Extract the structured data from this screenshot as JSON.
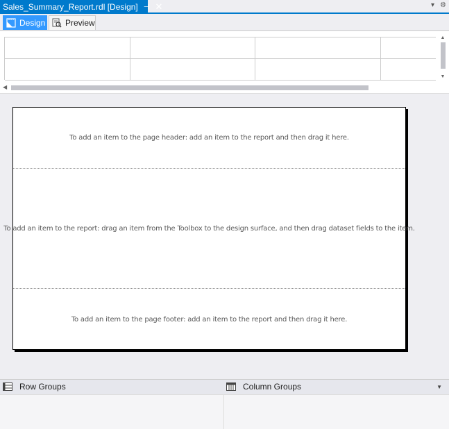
{
  "document_tab": {
    "title": "Sales_Summary_Report.rdl [Design]",
    "pin_glyph": "⊣",
    "close_glyph": "✕"
  },
  "window_controls": {
    "dropdown_glyph": "▾",
    "settings_glyph": "⚙"
  },
  "mode_tabs": {
    "design_label": "Design",
    "preview_label": "Preview",
    "active": "Design"
  },
  "dataset_grid": {
    "rows": 2,
    "columns": 4
  },
  "report": {
    "header_hint": "To add an item to the page header: add an item to the report and then drag it here.",
    "body_hint": "To add an item to the report: drag an item from the Toolbox to the design surface, and then drag dataset fields to the item.",
    "footer_hint": "To add an item to the page footer: add an item to the report and then drag it here."
  },
  "groups": {
    "row_groups_label": "Row Groups",
    "column_groups_label": "Column Groups"
  },
  "colors": {
    "accent": "#007acc",
    "active_tab": "#3399ff",
    "chrome": "#eeeef2"
  }
}
